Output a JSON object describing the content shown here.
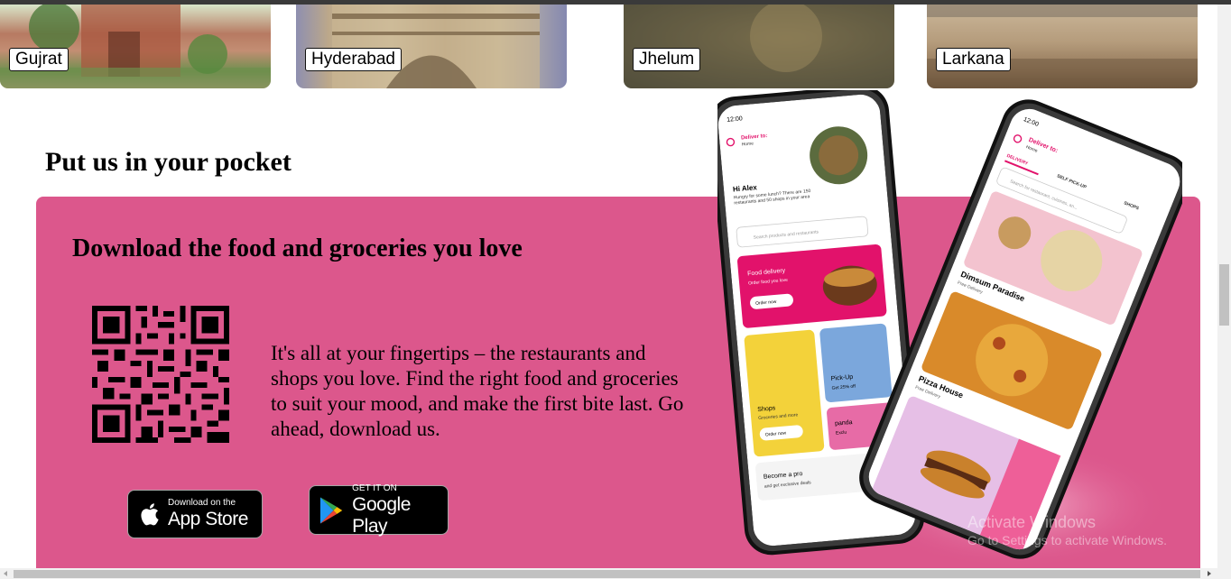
{
  "cities": [
    {
      "name": "Gujrat"
    },
    {
      "name": "Hyderabad"
    },
    {
      "name": "Jhelum"
    },
    {
      "name": "Larkana"
    }
  ],
  "pocket": {
    "title": "Put us in your pocket",
    "panel_title": "Download the food and groceries you love",
    "description": "It's all at your fingertips – the restaurants and shops you love. Find the right food and groceries to suit your mood, and make the first bite last. Go ahead, download us.",
    "app_store": {
      "small": "Download on the",
      "big": "App Store"
    },
    "google_play": {
      "small": "GET IT ON",
      "big": "Google Play"
    },
    "panel_color": "#dc578c"
  },
  "phone_left": {
    "time": "12:00",
    "deliver_label": "Deliver to:",
    "deliver_value": "Home",
    "greeting": "Hi Alex",
    "subtext": "Hungry for some lunch? There are 150 restaurants and 50 shops in your area",
    "search_placeholder": "Search products and restaurants",
    "food_delivery_title": "Food delivery",
    "food_delivery_sub": "Order food you love",
    "order_now": "Order now",
    "shops_title": "Shops",
    "shops_sub": "Groceries and more",
    "shops_order_now": "Order now",
    "pickup_title": "Pick-Up",
    "pickup_sub": "Get 25% off",
    "pandapro_title": "panda",
    "pandapro_sub": "Exclu",
    "pro_title": "Become a pro",
    "pro_sub": "and get exclusive deals"
  },
  "phone_right": {
    "time": "12:00",
    "deliver_label": "Deliver to:",
    "deliver_value": "Home",
    "tabs": [
      "DELIVERY",
      "SELF PICK-UP",
      "SHOPS"
    ],
    "search_placeholder": "Search for restaurant, cuisines, an...",
    "restaurants": [
      {
        "name": "Dimsum Paradise",
        "tag": "Free Delivery"
      },
      {
        "name": "Pizza House",
        "tag": "Free Delivery"
      }
    ]
  },
  "watermark": {
    "line1": "Activate Windows",
    "line2": "Go to Settings to activate Windows."
  },
  "icons": {
    "apple": "apple-icon",
    "google_play": "google-play-icon",
    "qr": "qr-code"
  }
}
